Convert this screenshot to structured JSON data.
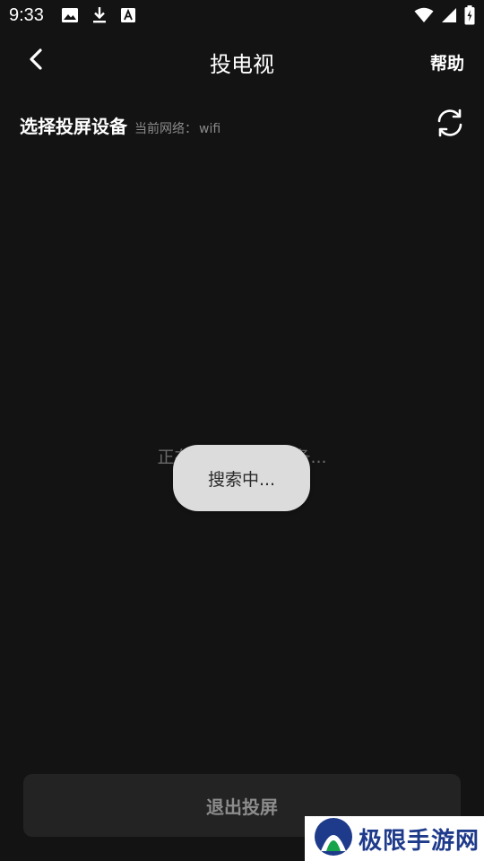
{
  "status_bar": {
    "time": "9:33",
    "left_icons": [
      "image-icon",
      "download-icon",
      "font-a-icon"
    ],
    "right_icons": [
      "wifi-icon",
      "cell-signal-icon",
      "battery-charging-icon"
    ]
  },
  "top_bar": {
    "back_icon": "chevron-left-icon",
    "title": "投电视",
    "help_label": "帮助"
  },
  "section": {
    "title": "选择投屏设备",
    "network_label": "当前网络：",
    "network_value": "wifi",
    "refresh_icon": "refresh-icon"
  },
  "status": {
    "searching_text": "正在搜索可连接设备..."
  },
  "toast": {
    "message": "搜索中..."
  },
  "footer": {
    "exit_label": "退出投屏"
  },
  "watermark": {
    "text": "极限手游网"
  },
  "colors": {
    "background": "#131313",
    "button_bg": "#232323",
    "muted_text": "#8a8a8a",
    "toast_bg": "#dcdcdc"
  }
}
